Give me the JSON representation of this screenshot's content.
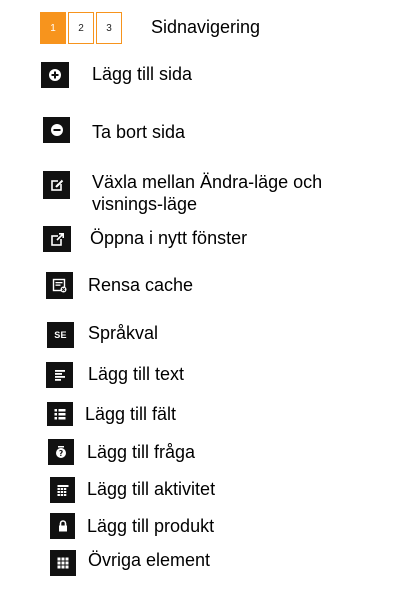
{
  "pager": {
    "pages": [
      "1",
      "2",
      "3"
    ],
    "active_index": 0,
    "title": "Sidnavigering",
    "accent_color": "#f7941d"
  },
  "legend": {
    "add_page": {
      "label": "Lägg till sida",
      "icon": "plus-circle-icon"
    },
    "remove_page": {
      "label": "Ta bort sida",
      "icon": "minus-circle-icon"
    },
    "toggle_mode": {
      "label": "Växla mellan Ändra-läge och visnings-läge",
      "icon": "edit-icon"
    },
    "open_window": {
      "label": "Öppna i nytt fönster",
      "icon": "external-link-icon"
    },
    "clear_cache": {
      "label": "Rensa cache",
      "icon": "clear-cache-icon"
    },
    "language": {
      "label": "Språkval",
      "icon": "language-icon",
      "icon_text": "SE"
    },
    "add_text": {
      "label": "Lägg till text",
      "icon": "text-align-icon"
    },
    "add_field": {
      "label": "Lägg till fält",
      "icon": "list-icon"
    },
    "add_question": {
      "label": "Lägg till fråga",
      "icon": "question-icon"
    },
    "add_activity": {
      "label": "Lägg till aktivitet",
      "icon": "calendar-icon"
    },
    "add_product": {
      "label": "Lägg till produkt",
      "icon": "lock-icon"
    },
    "other_elements": {
      "label": "Övriga element",
      "icon": "grid-icon"
    }
  }
}
